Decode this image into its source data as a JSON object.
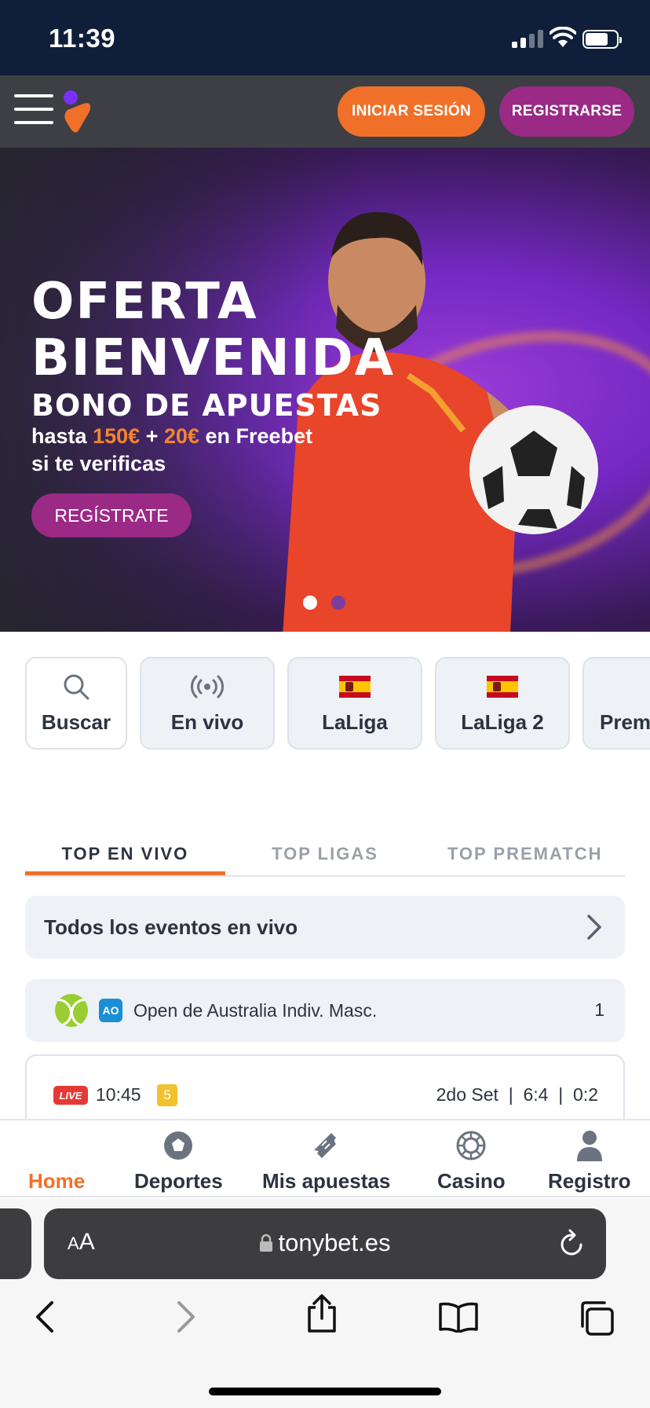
{
  "status": {
    "time": "11:39"
  },
  "header": {
    "login": "INICIAR SESIÓN",
    "register": "REGISTRARSE"
  },
  "hero": {
    "title_line1": "OFERTA",
    "title_line2": "BIENVENIDA",
    "subtitle": "BONO DE APUESTAS",
    "promo_prefix": "hasta",
    "amount1": "150€",
    "plus": "+",
    "amount2": "20€",
    "promo_suffix": "en Freebet",
    "promo_line2": "si te verificas",
    "cta": "REGÍSTRATE",
    "slides": 2,
    "active_slide": 1
  },
  "quick": [
    {
      "label": "Buscar",
      "icon": "search-icon"
    },
    {
      "label": "En vivo",
      "icon": "live-broadcast-icon"
    },
    {
      "label": "LaLiga",
      "icon": "spain-flag-icon"
    },
    {
      "label": "LaLiga 2",
      "icon": "spain-flag-icon"
    },
    {
      "label": "Prem",
      "icon": "league-icon"
    }
  ],
  "tabs": [
    "TOP EN VIVO",
    "TOP LIGAS",
    "TOP PREMATCH"
  ],
  "all_live": "Todos los eventos en vivo",
  "league": {
    "icon_text": "AO",
    "name": "Open de Australia Indiv. Masc.",
    "count": "1"
  },
  "match": {
    "live": "LIVE",
    "time": "10:45",
    "badge": "5",
    "set": "2do Set",
    "score1": "6:4",
    "score2": "0:2",
    "sep": "|"
  },
  "bottom_nav": [
    "Home",
    "Deportes",
    "Mis apuestas",
    "Casino",
    "Registro"
  ],
  "browser": {
    "aa": "A",
    "aa_big": "A",
    "url": "tonybet.es"
  },
  "colors": {
    "accent": "#f0702a",
    "brand_purple": "#9a2a86",
    "nav_bg": "#3d3f44"
  }
}
